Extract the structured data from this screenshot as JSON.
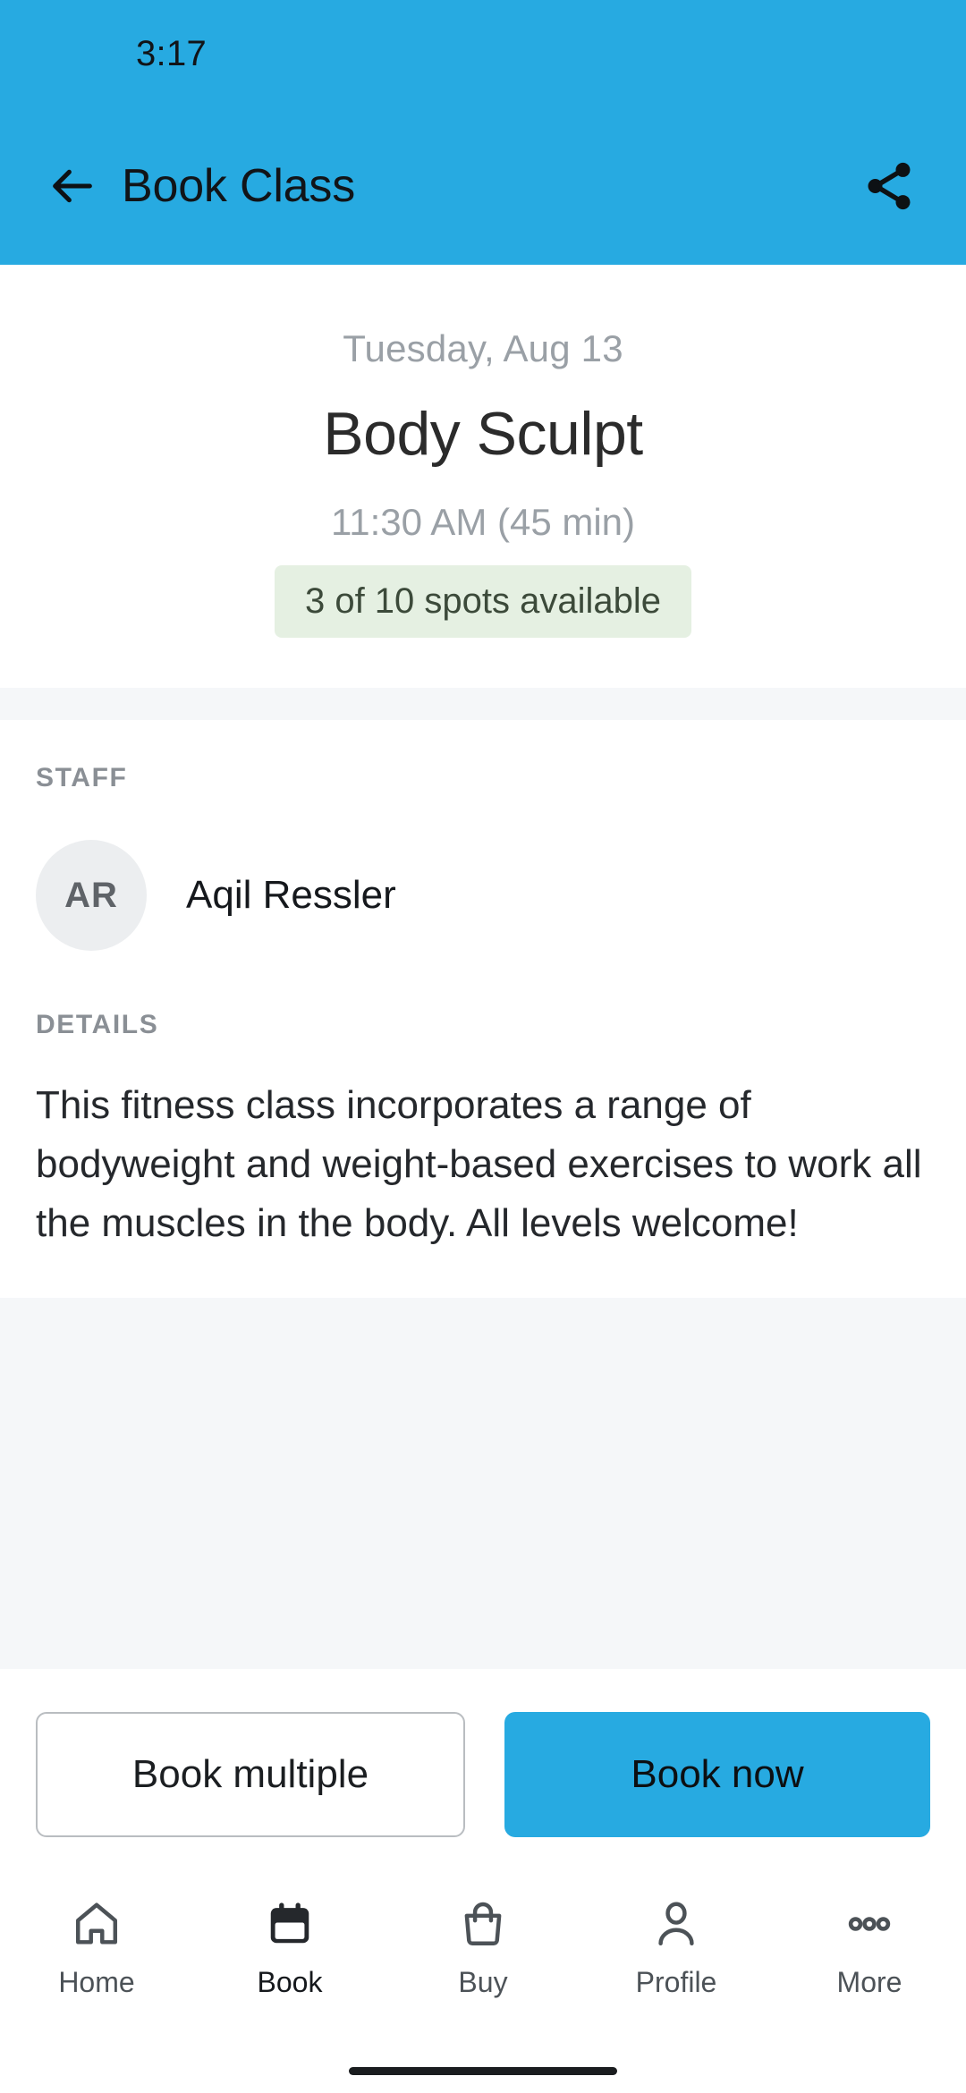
{
  "colors": {
    "brand_blue": "#27aae1",
    "badge_green_bg": "#e5f0e2",
    "badge_green_text": "#3c4a3a",
    "band_gray": "#f5f7f9",
    "muted_text": "#9aa0a6"
  },
  "status_bar": {
    "time": "3:17"
  },
  "appbar": {
    "title": "Book Class",
    "back_icon": "arrow-left-icon",
    "share_icon": "share-icon"
  },
  "class_summary": {
    "date": "Tuesday, Aug 13",
    "name": "Body Sculpt",
    "time": "11:30 AM (45 min)",
    "spots_badge": "3 of 10 spots available"
  },
  "staff": {
    "section_label": "STAFF",
    "members": [
      {
        "initials": "AR",
        "name": "Aqil Ressler"
      }
    ]
  },
  "details": {
    "section_label": "DETAILS",
    "text": "This fitness class incorporates a range of bodyweight and weight-based exercises to work all the muscles in the body. All levels welcome!"
  },
  "actions": {
    "secondary_label": "Book multiple",
    "primary_label": "Book now"
  },
  "bottom_nav": {
    "items": [
      {
        "label": "Home",
        "icon": "home-icon",
        "active": false
      },
      {
        "label": "Book",
        "icon": "calendar-icon",
        "active": true
      },
      {
        "label": "Buy",
        "icon": "shopping-bag-icon",
        "active": false
      },
      {
        "label": "Profile",
        "icon": "person-icon",
        "active": false
      },
      {
        "label": "More",
        "icon": "ellipsis-icon",
        "active": false
      }
    ]
  }
}
